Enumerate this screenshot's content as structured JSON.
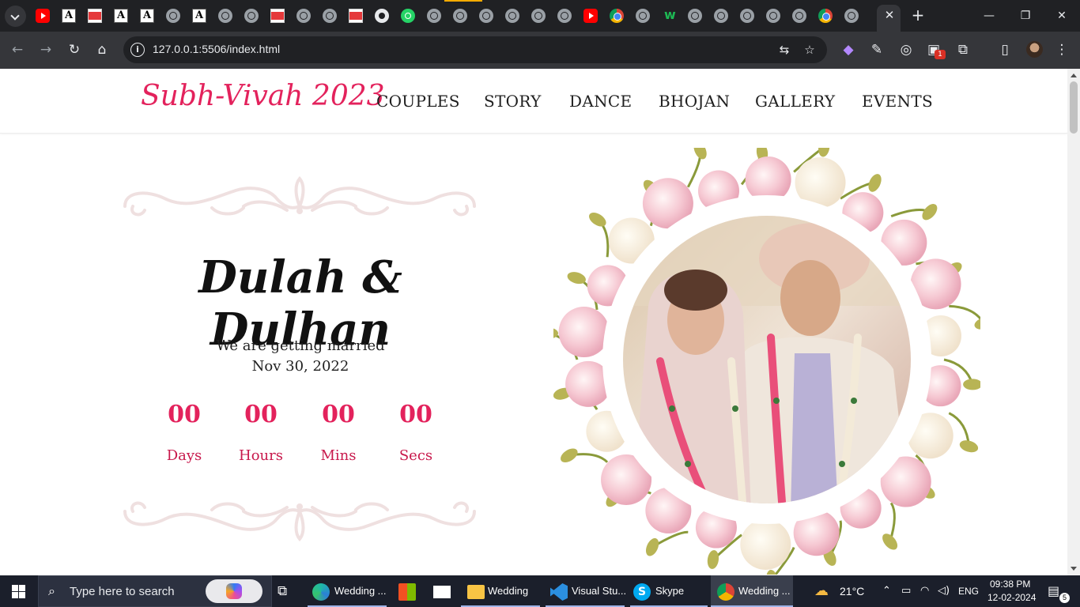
{
  "browser": {
    "tab_favicons": [
      "youtube-icon",
      "a-logo-icon",
      "red-bar-icon",
      "a-logo-icon",
      "a-logo-icon",
      "globe-icon",
      "a-logo-icon",
      "globe-icon",
      "globe-icon",
      "red-bar-icon",
      "globe-icon",
      "globe-icon",
      "red-bar-icon",
      "github-icon",
      "whatsapp-icon",
      "globe-icon",
      "globe-icon",
      "globe-icon",
      "globe-icon",
      "globe-icon",
      "globe-icon",
      "youtube-icon",
      "chrome-icon",
      "globe-icon",
      "w-icon",
      "globe-icon",
      "globe-icon",
      "globe-icon",
      "globe-icon",
      "globe-icon",
      "chrome-icon",
      "globe-icon"
    ],
    "active_tab_close": "✕",
    "new_tab": "+",
    "window_controls": {
      "minimize": "—",
      "restore": "❐",
      "close": "✕"
    },
    "nav": {
      "back": "←",
      "forward": "→",
      "reload": "↻",
      "home": "⌂"
    },
    "url": "127.0.0.1:5506/index.html",
    "extension_badge": "1"
  },
  "site": {
    "logo": "Subh-Vivah 2023",
    "nav": [
      "COUPLES",
      "STORY",
      "DANCE",
      "BHOJAN",
      "GALLERY",
      "EVENTS"
    ],
    "couple_name": "Dulah & Dulhan",
    "tagline": "We are getting married",
    "date": "Nov 30, 2022",
    "countdown": [
      {
        "value": "00",
        "label": "Days"
      },
      {
        "value": "00",
        "label": "Hours"
      },
      {
        "value": "00",
        "label": "Mins"
      },
      {
        "value": "00",
        "label": "Secs"
      }
    ],
    "colors": {
      "accent": "#e3225c",
      "ornament": "#efe0e0"
    }
  },
  "taskbar": {
    "search_placeholder": "Type here to search",
    "apps": [
      {
        "label": "Wedding ...",
        "icon": "edge-icon"
      },
      {
        "label": "",
        "icon": "store-icon"
      },
      {
        "label": "",
        "icon": "mail-icon"
      },
      {
        "label": "Wedding",
        "icon": "folder-icon"
      },
      {
        "label": "Visual Stu...",
        "icon": "vscode-icon"
      },
      {
        "label": "Skype",
        "icon": "skype-icon"
      },
      {
        "label": "Wedding ...",
        "icon": "chrome-icon"
      }
    ],
    "weather": "21°C",
    "language": "ENG",
    "time": "09:38 PM",
    "date": "12-02-2024",
    "notifications": "5"
  }
}
